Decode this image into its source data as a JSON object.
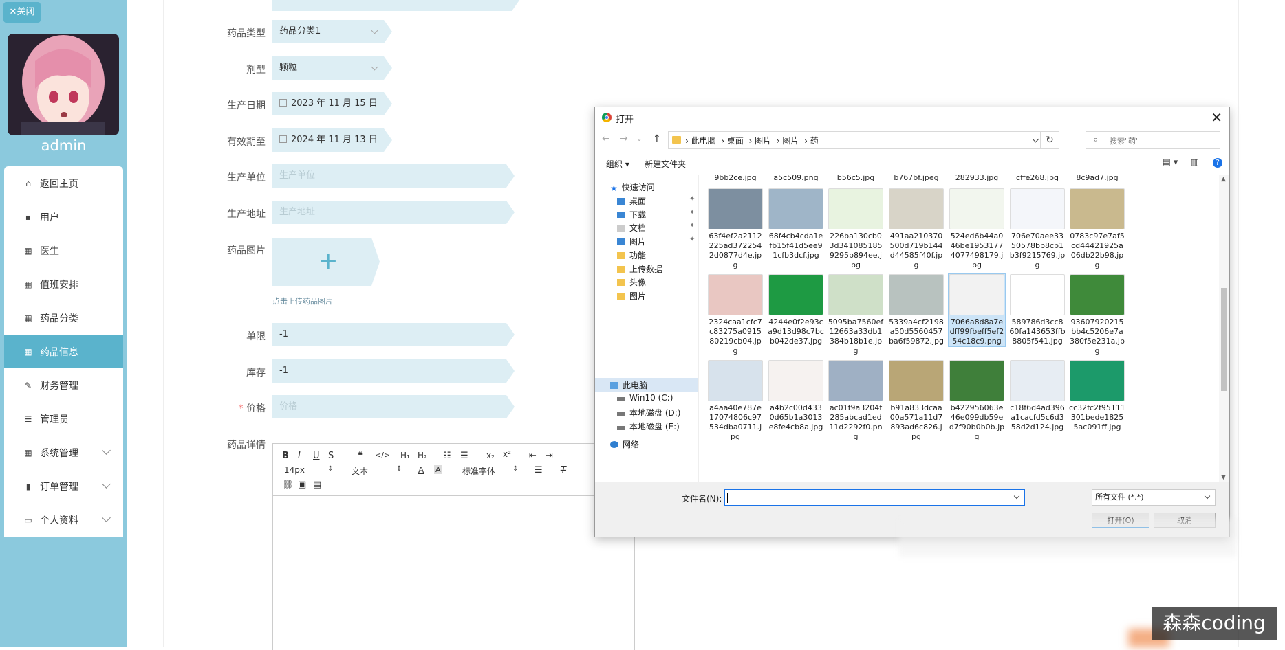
{
  "sidebar": {
    "close_label": "✕关闭",
    "username": "admin",
    "items": [
      {
        "label": "返回主页",
        "icon": "home-icon"
      },
      {
        "label": "用户",
        "icon": "user-icon"
      },
      {
        "label": "医生",
        "icon": "grid-icon"
      },
      {
        "label": "值班安排",
        "icon": "grid-icon"
      },
      {
        "label": "药品分类",
        "icon": "grid-icon"
      },
      {
        "label": "药品信息",
        "icon": "grid-icon",
        "active": true
      },
      {
        "label": "财务管理",
        "icon": "edit-icon"
      },
      {
        "label": "管理员",
        "icon": "list-icon"
      },
      {
        "label": "系统管理",
        "icon": "grid-icon",
        "expandable": true
      },
      {
        "label": "订单管理",
        "icon": "chart-icon",
        "expandable": true
      },
      {
        "label": "个人资料",
        "icon": "card-icon",
        "expandable": true
      }
    ]
  },
  "form": {
    "drug_type": {
      "label": "药品类型",
      "value": "药品分类1"
    },
    "dosage_form": {
      "label": "剂型",
      "value": "颗粒"
    },
    "production_date": {
      "label": "生产日期",
      "value": "2023 年 11 月 15 日"
    },
    "expiry_date": {
      "label": "有效期至",
      "value": "2024 年 11 月 13 日"
    },
    "manufacturer": {
      "label": "生产单位",
      "placeholder": "生产单位"
    },
    "address": {
      "label": "生产地址",
      "placeholder": "生产地址"
    },
    "image": {
      "label": "药品图片",
      "hint": "点击上传药品图片"
    },
    "limit": {
      "label": "单限",
      "value": "-1"
    },
    "stock": {
      "label": "库存",
      "value": "-1"
    },
    "price": {
      "label": "价格",
      "placeholder": "价格",
      "required_mark": "*"
    },
    "details": {
      "label": "药品详情"
    }
  },
  "editor": {
    "font_size": "14px",
    "text_style": "文本",
    "font_family": "标准字体"
  },
  "dialog": {
    "title": "打开",
    "breadcrumbs": [
      "此电脑",
      "桌面",
      "图片",
      "图片",
      "药"
    ],
    "search_placeholder": "搜索\"药\"",
    "organize": "组织 ▾",
    "new_folder": "新建文件夹",
    "nav": [
      {
        "label": "快速访问",
        "icon": "star-icon",
        "indent": 0
      },
      {
        "label": "桌面",
        "icon": "desktop-icon",
        "indent": 1,
        "pinned": true
      },
      {
        "label": "下载",
        "icon": "download-icon",
        "indent": 1,
        "pinned": true
      },
      {
        "label": "文档",
        "icon": "document-icon",
        "indent": 1,
        "pinned": true
      },
      {
        "label": "图片",
        "icon": "pictures-icon",
        "indent": 1,
        "pinned": true
      },
      {
        "label": "功能",
        "icon": "folder-icon",
        "indent": 1
      },
      {
        "label": "上传数据",
        "icon": "folder-icon",
        "indent": 1
      },
      {
        "label": "头像",
        "icon": "folder-icon",
        "indent": 1
      },
      {
        "label": "图片",
        "icon": "folder-icon",
        "indent": 1
      },
      {
        "label": "此电脑",
        "icon": "pc-icon",
        "indent": 0,
        "selected": true
      },
      {
        "label": "Win10 (C:)",
        "icon": "drive-icon",
        "indent": 1
      },
      {
        "label": "本地磁盘 (D:)",
        "icon": "drive-icon",
        "indent": 1
      },
      {
        "label": "本地磁盘 (E:)",
        "icon": "drive-icon",
        "indent": 1
      },
      {
        "label": "网络",
        "icon": "network-icon",
        "indent": 0
      }
    ],
    "top_row_names": [
      "9bb2ce.jpg",
      "a5c509.png",
      "b56c5.jpg",
      "b767bf.jpeg",
      "282933.jpg",
      "cffe268.jpg",
      "8c9ad7.jpg"
    ],
    "files": [
      {
        "name": "63f4ef2a2112225ad3722542d0877d4e.jpg",
        "color": "#7d8fa0"
      },
      {
        "name": "68f4cb4cda1efb15f41d5ee91cfb3dcf.jpg",
        "color": "#9fb5c8"
      },
      {
        "name": "226ba130cb03d3410851859295b894ee.jpg",
        "color": "#e8f3e0"
      },
      {
        "name": "491aa210370500d719b144d44585f40f.jpg",
        "color": "#d8d4c8"
      },
      {
        "name": "524ed6b44a046be19531774077498179.jpg",
        "color": "#f2f6ee"
      },
      {
        "name": "706e70aee3350578bb8cb1b3f9215769.jpg",
        "color": "#f4f6fa"
      },
      {
        "name": "0783c97e7af5cd44421925a06db22b98.jpg",
        "color": "#c9b98e"
      },
      {
        "name": "2324caa1cfc7c83275a091580219cb04.jpg",
        "color": "#e9c7c2"
      },
      {
        "name": "4244e0f2e93ca9d13d98c7bcb042de37.jpg",
        "color": "#1e9a43"
      },
      {
        "name": "5095ba7560ef12663a33db1384b18b1e.jpg",
        "color": "#cfe0c8"
      },
      {
        "name": "5339a4cf2198a50d5560457ba6f59872.jpg",
        "color": "#b8c2bf"
      },
      {
        "name": "7066a8d8a7edff99fbeff5ef254c18c9.png",
        "color": "#f2f2f2",
        "selected": true
      },
      {
        "name": "589786d3cc860fa143653ffb8805f541.jpg",
        "color": "#ffffff"
      },
      {
        "name": "93607920215bb4c5206e7a380f5e231a.jpg",
        "color": "#3f8a3a"
      },
      {
        "name": "a4aa40e787e17074806c97534dba0711.jpg",
        "color": "#d7e2ec"
      },
      {
        "name": "a4b2c00d4330d65b1a3013e8fe4cb8a.jpg",
        "color": "#f6f2f0"
      },
      {
        "name": "ac01f9a3204f285abcad1ed11d2292f0.png",
        "color": "#9fb0c4"
      },
      {
        "name": "b91a833dcaa00a571a11d7893ad6c826.jpg",
        "color": "#b9a676"
      },
      {
        "name": "b422956063e46e099db59ed7f90b0b0b.jpg",
        "color": "#3f7f3a"
      },
      {
        "name": "c18f6d4ad396a1cacfd5c6d358d2d124.jpg",
        "color": "#e7edf3"
      },
      {
        "name": "cc32fc2f95111301bede18255ac091ff.jpg",
        "color": "#1c9a6a"
      }
    ],
    "filename_label": "文件名(N):",
    "filename_value": "",
    "filetype": "所有文件 (*.*)",
    "open_button": "打开(O)",
    "cancel_button": "取消"
  },
  "watermark": "森森coding"
}
